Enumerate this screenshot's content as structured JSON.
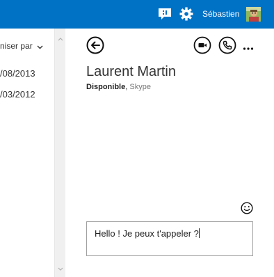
{
  "topbar": {
    "user_name": "Sébastien",
    "chat_icon": "chat-bubble-icon",
    "settings_icon": "gear-icon",
    "avatar": "user-avatar",
    "background_color": "#0072c6"
  },
  "message_list": {
    "arrange_label": "niser par",
    "dates": [
      "/08/2013",
      "/03/2012"
    ]
  },
  "conversation": {
    "contact_name": "Laurent Martin",
    "status": "Disponible",
    "status_separator": ",",
    "service": "Skype",
    "icons": {
      "back": "back-arrow-circle-icon",
      "video": "video-call-icon",
      "call": "phone-call-icon",
      "more": "more-ellipsis-icon",
      "emoji": "smiley-icon"
    },
    "message_draft": "Hello ! Je peux t'appeler ?"
  }
}
